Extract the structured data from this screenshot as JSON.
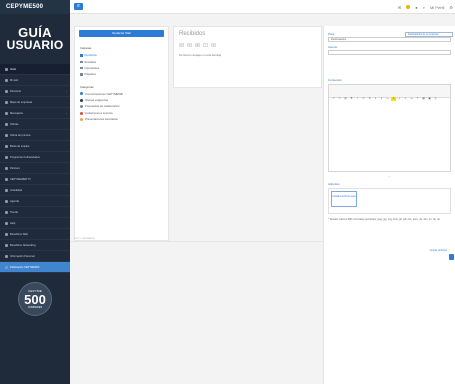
{
  "brand": "CEPYME500",
  "logo": {
    "line1": "GUÍA",
    "line2": "USUARIO"
  },
  "sidebar": {
    "items": [
      {
        "label": "Inicio"
      },
      {
        "label": "Mi web"
      },
      {
        "label": "Directorio"
      },
      {
        "label": "Mapa de empresas"
      },
      {
        "label": "Mensajería"
      },
      {
        "label": "Ofertas"
      },
      {
        "label": "Oferta de primera"
      },
      {
        "label": "Bolsa de empleo"
      },
      {
        "label": "Programas Cofinanciados"
      },
      {
        "label": "Partners"
      },
      {
        "label": "CEPYMEWEB TV"
      },
      {
        "label": "Actualidad"
      },
      {
        "label": "Agenda"
      },
      {
        "label": "Tienda"
      },
      {
        "label": "Help"
      },
      {
        "label": "Beneficios Web"
      },
      {
        "label": "Beneficios Networking"
      },
      {
        "label": "Información Personal"
      },
      {
        "label": "Publicación CEPYME500"
      }
    ]
  },
  "badge": {
    "top": "CEPYME",
    "number": "500",
    "bottom": "COMPANIES"
  },
  "topbar": {
    "menu_icon": "≡",
    "right_text": "Mi Perfil"
  },
  "mailnav": {
    "compose_label": "Redactar Mail",
    "folders_title": "Carpetas",
    "folders": [
      {
        "label": "Recibidos"
      },
      {
        "label": "Enviados"
      },
      {
        "label": "Importantes"
      },
      {
        "label": "Papelera"
      }
    ],
    "categories_title": "Categorías",
    "categories": [
      {
        "label": "Comunicaciones CEPYME500",
        "color": "#2d7bd6"
      },
      {
        "label": "Ofertas exigencias",
        "color": "#2b3a4e"
      },
      {
        "label": "Propuestas de colaboración",
        "color": "#7b8794"
      },
      {
        "label": "Invitaciones a eventos",
        "color": "#e2463d"
      },
      {
        "label": "Presentaciones Asociados",
        "color": "#f0a63a"
      }
    ]
  },
  "inbox": {
    "title": "Recibidos",
    "empty_text": "No tienes mensajes en esta bandeja"
  },
  "composer": {
    "to_label": "Para",
    "to_value": "Destinatarios",
    "select_value": "Destinatarios de su empresa",
    "subject_label": "Asunto",
    "content_label": "Contenido",
    "attach_label": "Adjuntos",
    "dropzone_text": "Arrastra archivos aquí",
    "note": "* Tamaño máximo 5Mb | Formatos permitidos: jpeg, jpg, png, bmp, gif, pdf, doc, docx, xls, xlsx, txt, zip, rar",
    "clean_label": "Limpiar archivos",
    "send_label": ""
  },
  "footer": {
    "copyright": "2017 © CEPYME500"
  }
}
